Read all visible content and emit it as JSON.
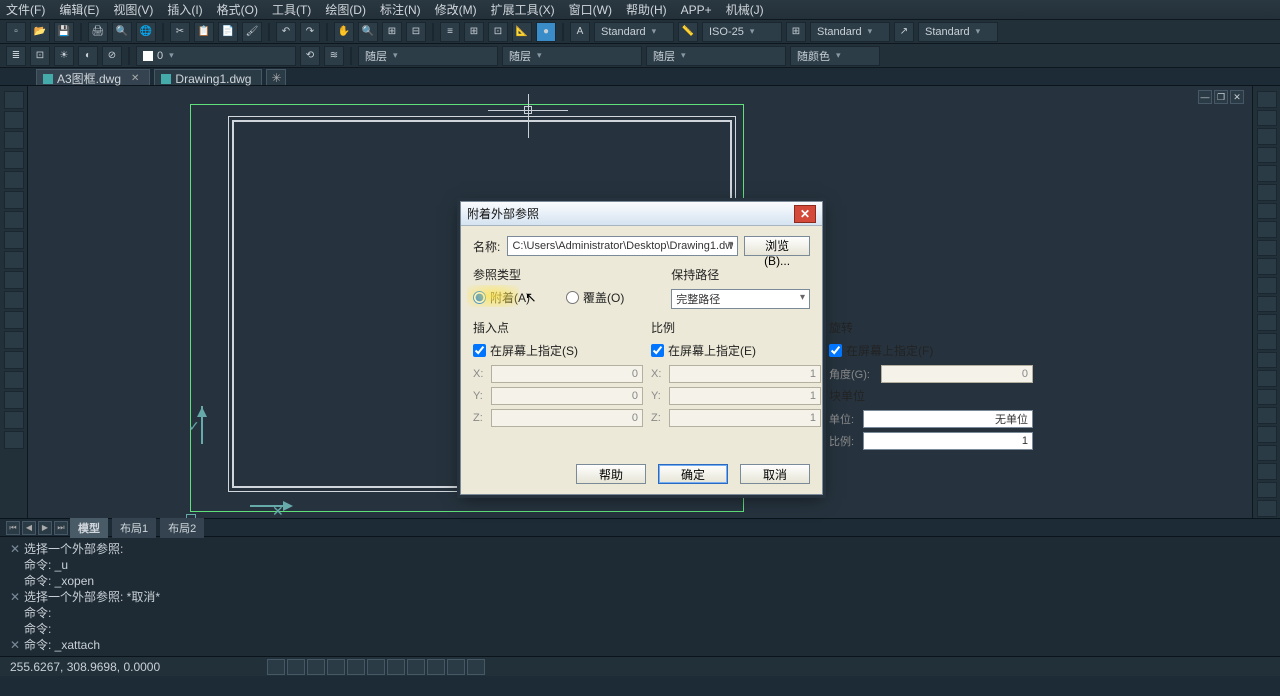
{
  "menu": [
    "文件(F)",
    "编辑(E)",
    "视图(V)",
    "插入(I)",
    "格式(O)",
    "工具(T)",
    "绘图(D)",
    "标注(N)",
    "修改(M)",
    "扩展工具(X)",
    "窗口(W)",
    "帮助(H)",
    "APP+",
    "机械(J)"
  ],
  "toolbar2": {
    "style1": "Standard",
    "style2": "ISO-25",
    "style3": "Standard",
    "style4": "Standard"
  },
  "toolbar3": {
    "layerColor": "随层",
    "layer": "随层",
    "color": "随颜色"
  },
  "tabs": [
    {
      "label": "A3图框.dwg",
      "active": true
    },
    {
      "label": "Drawing1.dwg",
      "active": false
    }
  ],
  "dialog": {
    "title": "附着外部参照",
    "name_label": "名称:",
    "name_value": "C:\\Users\\Administrator\\Desktop\\Drawing1.dw",
    "browse": "浏览(B)...",
    "reftype": "参照类型",
    "attach": "附着(A)",
    "overlay": "覆盖(O)",
    "pathkeep": "保持路径",
    "pathval": "完整路径",
    "insert": "插入点",
    "scale": "比例",
    "rotate": "旋转",
    "spec_s": "在屏幕上指定(S)",
    "spec_e": "在屏幕上指定(E)",
    "spec_f": "在屏幕上指定(F)",
    "x": "X:",
    "y": "Y:",
    "z": "Z:",
    "ix": "0",
    "iy": "0",
    "iz": "0",
    "sx": "1",
    "sy": "1",
    "sz": "1",
    "ang_lab": "角度(G):",
    "ang": "0",
    "block_unit": "块单位",
    "unit_lab": "单位:",
    "unit_val": "无单位",
    "scale_lab": "比例:",
    "scale_val": "1",
    "help": "帮助",
    "ok": "确定",
    "cancel": "取消"
  },
  "model_tabs": [
    "模型",
    "布局1",
    "布局2"
  ],
  "cmd_lines": [
    "选择一个外部参照:",
    "命令: _u",
    "命令: _xopen",
    "选择一个外部参照: *取消*",
    "命令:",
    "命令:",
    "命令: _xattach"
  ],
  "status": {
    "coords": "255.6267, 308.9698, 0.0000"
  }
}
